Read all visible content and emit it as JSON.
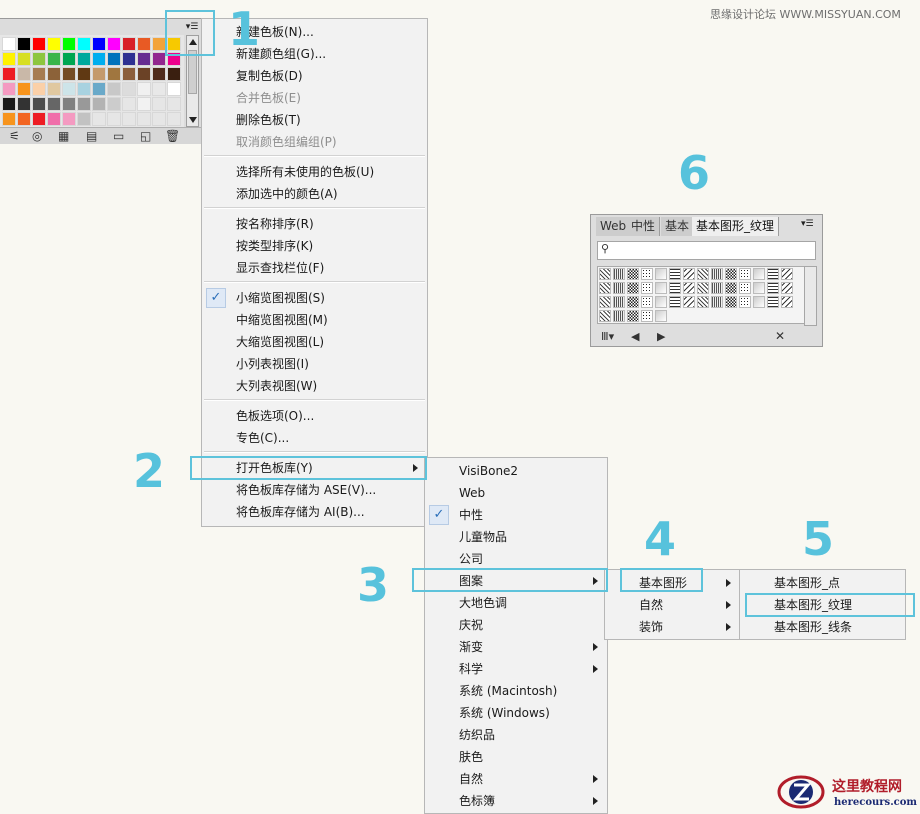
{
  "swatch_panel": {
    "menu_button_icon": "panel-menu-icon",
    "swatch_colors": [
      [
        "#ffffff",
        "#000000",
        "#ff0000",
        "#ffff00",
        "#00ff00",
        "#00ffff",
        "#0000ff",
        "#ff00ff",
        "#d82027",
        "#e85a24",
        "#f3a33a",
        "#f7c900"
      ],
      [
        "#fff200",
        "#d7df23",
        "#8dc63f",
        "#39b54a",
        "#00a651",
        "#00a99d",
        "#00aeef",
        "#0072bc",
        "#2e3192",
        "#662d91",
        "#92278f",
        "#ec008c"
      ],
      [
        "#ed1c24",
        "#c9b8a8",
        "#a67c52",
        "#8c6239",
        "#754c24",
        "#603913",
        "#c49a6c",
        "#a0763f",
        "#8b5e3c",
        "#6b4226",
        "#4f2c1d",
        "#3a1f10"
      ],
      [
        "#f49ac1",
        "#f7941d",
        "#fbd0a8",
        "#e0c8a0",
        "#cde4e9",
        "#a8d2e0",
        "#6aa9c9",
        "#c8c8c8",
        "#dcdcdc",
        "#f0f0f0",
        "#e8e8e8",
        "#ffffff"
      ],
      [
        "#1a1a1a",
        "#333333",
        "#4d4d4d",
        "#666666",
        "#808080",
        "#999999",
        "#b3b3b3",
        "#cccccc",
        "#e6e6e6",
        "#f2f2f2",
        "#e6e6e6",
        "#e6e6e6"
      ],
      [
        "#f7941d",
        "#f26522",
        "#ed1c24",
        "#f06eaa",
        "#f49ac1",
        "#c2c2c2",
        "#e6e6e6",
        "#e6e6e6",
        "#e6e6e6",
        "#e6e6e6",
        "#e6e6e6",
        "#e6e6e6"
      ]
    ],
    "toolbar_icons": [
      "library-icon",
      "show-kinds-icon",
      "swatch-options-icon",
      "new-color-group-icon",
      "new-swatch-icon",
      "delete-swatch-icon"
    ]
  },
  "main_menu": {
    "groups": [
      [
        {
          "label": "新建色板(N)...",
          "disabled": false
        },
        {
          "label": "新建颜色组(G)...",
          "disabled": false
        },
        {
          "label": "复制色板(D)",
          "disabled": false
        },
        {
          "label": "合并色板(E)",
          "disabled": true
        },
        {
          "label": "删除色板(T)",
          "disabled": false
        },
        {
          "label": "取消颜色组编组(P)",
          "disabled": true
        }
      ],
      [
        {
          "label": "选择所有未使用的色板(U)",
          "disabled": false
        },
        {
          "label": "添加选中的颜色(A)",
          "disabled": false
        }
      ],
      [
        {
          "label": "按名称排序(R)",
          "disabled": false
        },
        {
          "label": "按类型排序(K)",
          "disabled": false
        },
        {
          "label": "显示查找栏位(F)",
          "disabled": false
        }
      ],
      [
        {
          "label": "小缩览图视图(S)",
          "checked": true
        },
        {
          "label": "中缩览图视图(M)"
        },
        {
          "label": "大缩览图视图(L)"
        },
        {
          "label": "小列表视图(I)"
        },
        {
          "label": "大列表视图(W)"
        }
      ],
      [
        {
          "label": "色板选项(O)..."
        },
        {
          "label": "专色(C)..."
        }
      ],
      [
        {
          "label": "打开色板库(Y)",
          "submenu": true
        },
        {
          "label": "将色板库存储为 ASE(V)..."
        },
        {
          "label": "将色板库存储为 AI(B)..."
        }
      ]
    ],
    "check_mark": "✓"
  },
  "library_menu": {
    "items": [
      {
        "label": "VisiBone2"
      },
      {
        "label": "Web"
      },
      {
        "label": "中性",
        "checked": true
      },
      {
        "label": "儿童物品"
      },
      {
        "label": "公司"
      },
      {
        "label": "图案",
        "submenu": true
      },
      {
        "label": "大地色调"
      },
      {
        "label": "庆祝"
      },
      {
        "label": "渐变",
        "submenu": true
      },
      {
        "label": "科学",
        "submenu": true
      },
      {
        "label": "系统 (Macintosh)"
      },
      {
        "label": "系统 (Windows)"
      },
      {
        "label": "纺织品"
      },
      {
        "label": "肤色"
      },
      {
        "label": "自然",
        "submenu": true
      },
      {
        "label": "色标簿",
        "submenu": true
      }
    ]
  },
  "pattern_menu": {
    "items": [
      {
        "label": "基本图形",
        "submenu": true
      },
      {
        "label": "自然",
        "submenu": true
      },
      {
        "label": "装饰",
        "submenu": true
      }
    ]
  },
  "basic_shape_menu": {
    "items": [
      {
        "label": "基本图形_点"
      },
      {
        "label": "基本图形_纹理"
      },
      {
        "label": "基本图形_线条"
      }
    ]
  },
  "callouts": {
    "c1": "1",
    "c2": "2",
    "c3": "3",
    "c4": "4",
    "c5": "5",
    "c6": "6"
  },
  "library_panel": {
    "tabs": [
      "Web",
      "中性",
      "基本",
      "基本图形_纹理"
    ],
    "menu_icon": "panel-menu-icon",
    "search_icon": "search-icon",
    "toolbar_icons": [
      "library-menu-icon",
      "previous-library-icon",
      "next-library-icon",
      "close-library-icon"
    ]
  },
  "watermarks": {
    "top": "思缘设计论坛 WWW.MISSYUAN.COM",
    "logo_text": "这里教程网",
    "logo_url": "herecours.com"
  }
}
